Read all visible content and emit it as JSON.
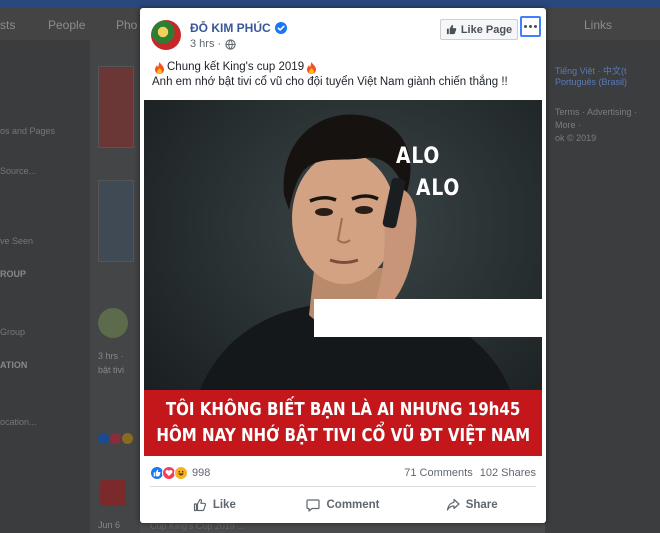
{
  "background": {
    "tabs": [
      "sts",
      "People",
      "Pho",
      "Links"
    ],
    "left_items": [
      "os and Pages",
      "Source...",
      "ve Seen",
      "ROUP",
      "Group",
      "ATION",
      "ocation..."
    ],
    "right_items": [
      "Tiếng Việt · 中文(t",
      "Português (Brasil)",
      "Terms · Advertising ·",
      "More ·",
      "ok © 2019"
    ],
    "center_meta": [
      "3 hrs · ",
      "bật tivi",
      "Jun 6"
    ],
    "bottom_text": "Cúp King's Cup 2019 ..."
  },
  "post": {
    "author": "ĐỖ KIM PHÚC",
    "time": "3 hrs",
    "like_page_label": "Like Page",
    "text_line1": "Chung kết King's cup 2019",
    "text_line2": "Anh em nhớ bật tivi cổ vũ cho đội tuyển Việt Nam giành chiến thắng !!",
    "image": {
      "alo1": "ALO",
      "alo2": "ALO",
      "banner_line1": "TÔI KHÔNG BIẾT BẠN LÀ AI NHƯNG 19h45",
      "banner_line2": "HÔM NAY NHỚ BẬT TIVI CỔ VŨ ĐT VIỆT NAM"
    },
    "reaction_count": "998",
    "comments": "71 Comments",
    "shares": "102 Shares",
    "actions": {
      "like": "Like",
      "comment": "Comment",
      "share": "Share"
    }
  },
  "colors": {
    "accent": "#385898",
    "banner": "#c4171c",
    "like_blue": "#1877f2",
    "love_red": "#f33e58",
    "haha_yellow": "#f7b125"
  }
}
